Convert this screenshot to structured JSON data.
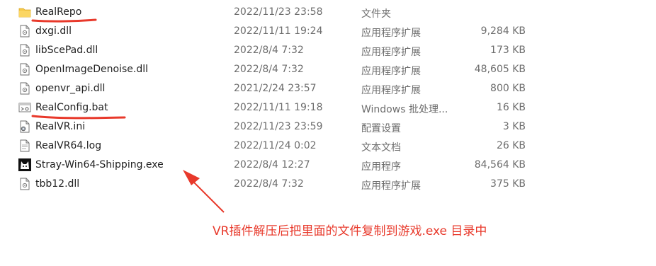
{
  "files": [
    {
      "icon": "folder-icon",
      "name": "RealRepo",
      "date": "2022/11/23 23:58",
      "type": "文件夹",
      "size": ""
    },
    {
      "icon": "dll-file-icon",
      "name": "dxgi.dll",
      "date": "2022/11/11 19:24",
      "type": "应用程序扩展",
      "size": "9,284 KB"
    },
    {
      "icon": "dll-file-icon",
      "name": "libScePad.dll",
      "date": "2022/8/4 7:32",
      "type": "应用程序扩展",
      "size": "173 KB"
    },
    {
      "icon": "dll-file-icon",
      "name": "OpenImageDenoise.dll",
      "date": "2022/8/4 7:32",
      "type": "应用程序扩展",
      "size": "48,605 KB"
    },
    {
      "icon": "dll-file-icon",
      "name": "openvr_api.dll",
      "date": "2021/2/24 23:57",
      "type": "应用程序扩展",
      "size": "800 KB"
    },
    {
      "icon": "batch-file-icon",
      "name": "RealConfig.bat",
      "date": "2022/11/11 19:18",
      "type": "Windows 批处理...",
      "size": "16 KB"
    },
    {
      "icon": "ini-file-icon",
      "name": "RealVR.ini",
      "date": "2022/11/23 23:59",
      "type": "配置设置",
      "size": "3 KB"
    },
    {
      "icon": "text-file-icon",
      "name": "RealVR64.log",
      "date": "2022/11/24 0:02",
      "type": "文本文档",
      "size": "26 KB"
    },
    {
      "icon": "stray-game-icon",
      "name": "Stray-Win64-Shipping.exe",
      "date": "2022/8/4 12:27",
      "type": "应用程序",
      "size": "84,564 KB"
    },
    {
      "icon": "dll-file-icon",
      "name": "tbb12.dll",
      "date": "2022/8/4 7:32",
      "type": "应用程序扩展",
      "size": "375 KB"
    }
  ],
  "annotation": {
    "text": "VR插件解压后把里面的文件复制到游戏.exe 目录中",
    "color": "#e8392b"
  },
  "colors": {
    "folder": "#f7c948",
    "annotation_red": "#e8392b"
  }
}
